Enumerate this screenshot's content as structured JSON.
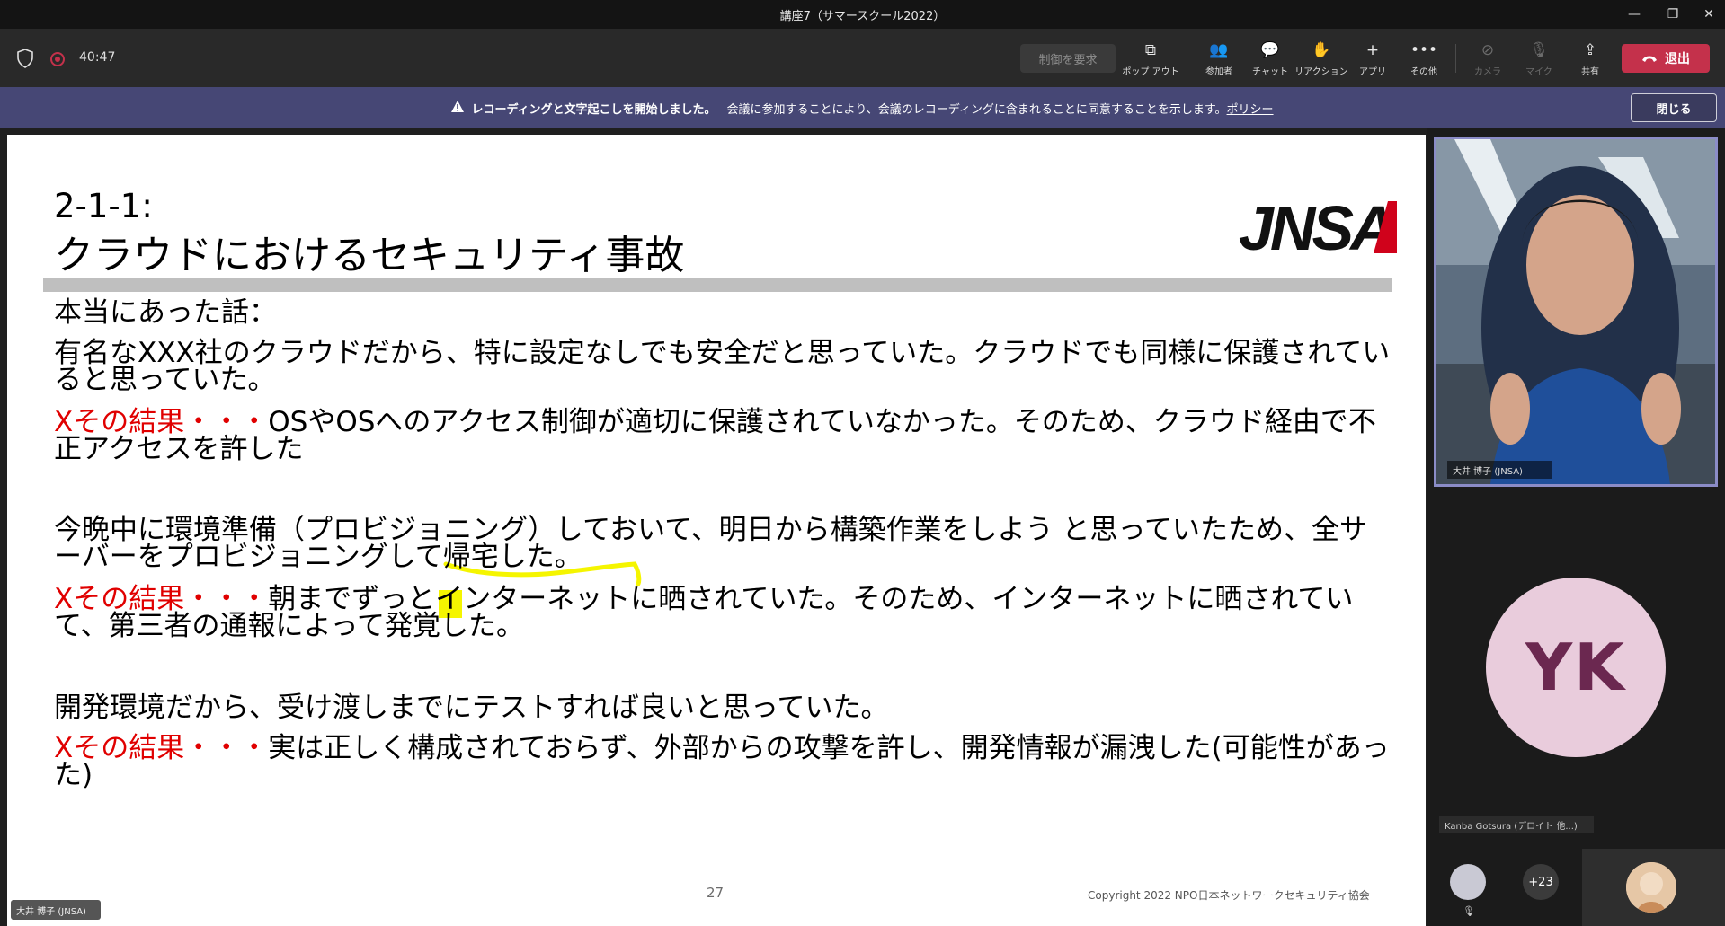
{
  "window": {
    "title": "講座7（サマースクール2022）",
    "controls": {
      "minimize": "—",
      "restore": "❐",
      "close": "✕"
    }
  },
  "toolbar": {
    "timer": "40:47",
    "request_control_label": "制御を要求",
    "buttons": [
      {
        "label": "ポップ アウト",
        "icon": "popout-icon",
        "glyph": "⧉"
      },
      {
        "label": "参加者",
        "icon": "participants-icon",
        "glyph": "👥"
      },
      {
        "label": "チャット",
        "icon": "chat-icon",
        "glyph": "💬"
      },
      {
        "label": "リアクション",
        "icon": "reaction-icon",
        "glyph": "✋"
      },
      {
        "label": "アプリ",
        "icon": "apps-icon",
        "glyph": "+"
      },
      {
        "label": "その他",
        "icon": "more-icon",
        "glyph": "•••"
      },
      {
        "label": "カメラ",
        "icon": "camera-off-icon",
        "glyph": "⊘"
      },
      {
        "label": "マイク",
        "icon": "mic-off-icon",
        "glyph": "🎙"
      },
      {
        "label": "共有",
        "icon": "share-icon",
        "glyph": "⇪"
      }
    ],
    "leave_label": "退出",
    "leave_color": "#c4314b"
  },
  "banner": {
    "bold_text": "レコーディングと文字起こしを開始しました。",
    "text": "会議に参加することにより、会議のレコーディングに含まれることに同意することを示します。",
    "link_text": "ポリシー",
    "close_label": "閉じる",
    "background": "#464775"
  },
  "slide": {
    "number_label": "2-1-1:",
    "title": "クラウドにおけるセキュリティ事故",
    "logo_text": "JNSA",
    "intro": "本当にあった話：",
    "items": [
      {
        "case": "有名なXXX社のクラウドだから、特に設定なしでも安全だと思っていた。クラウドでも同様に保護されていると思っていた。",
        "result_label": "Xその結果・・・",
        "result": "OSやOSへのアクセス制御が適切に保護されていなかった。そのため、クラウド経由で不正アクセスを許した"
      },
      {
        "case": "今晩中に環境準備（プロビジョニング）しておいて、明日から構築作業をしよう と思っていたため、全サーバーをプロビジョニングして帰宅した。",
        "result_label": "Xその結果・・・",
        "result": "朝までずっとインターネットに晒されていた。そのため、インターネットに晒されていて、第三者の通報によって発覚した。"
      },
      {
        "case": "開発環境だから、受け渡しまでにテストすれば良いと思っていた。",
        "result_label": "Xその結果・・・",
        "result": "実は正しく構成されておらず、外部からの攻撃を許し、開発情報が漏洩した(可能性があった)"
      }
    ],
    "page_number": "27",
    "copyright": "Copyright  2022  NPO日本ネットワークセキュリティ協会",
    "accent_red": "#e00000",
    "highlight_color": "#f5f500"
  },
  "participants": {
    "presenter_tag": "大井 博子 (JNSA)",
    "video_name": "大井 博子 (JNSA)",
    "yk_initials": "YK",
    "yk_name": "Kanba Gotsura (デロイト 他...)",
    "more_count": "+23"
  }
}
